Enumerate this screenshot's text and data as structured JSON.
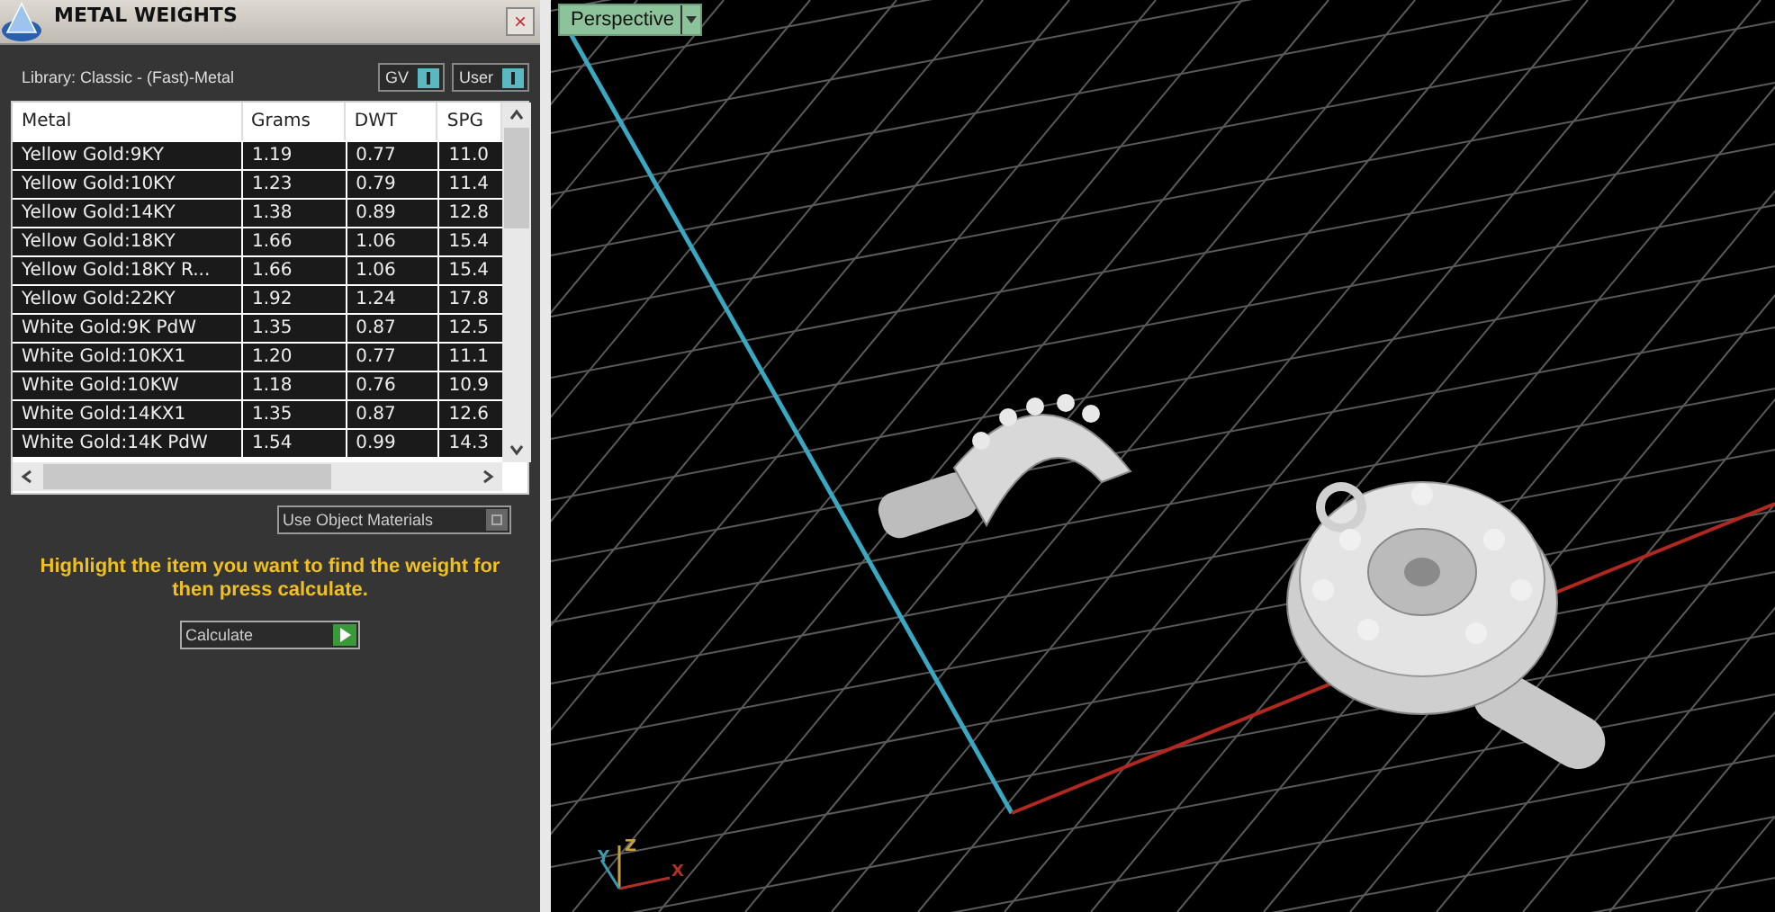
{
  "panel": {
    "title": "METAL WEIGHTS",
    "close": "×",
    "library": "Library: Classic - (Fast)-Metal",
    "toggles": [
      {
        "label": "GV",
        "on": true
      },
      {
        "label": "User",
        "on": true
      }
    ],
    "table": {
      "columns": [
        "Metal",
        "Grams",
        "DWT",
        "SPG"
      ],
      "rows": [
        {
          "cells": [
            "Yellow Gold:9KY",
            "1.19",
            "0.77",
            "11.0"
          ],
          "selected": false
        },
        {
          "cells": [
            "Yellow Gold:10KY",
            "1.23",
            "0.79",
            "11.4"
          ],
          "selected": false
        },
        {
          "cells": [
            "Yellow Gold:14KY",
            "1.38",
            "0.89",
            "12.8"
          ],
          "selected": false
        },
        {
          "cells": [
            "Yellow Gold:18KY",
            "1.66",
            "1.06",
            "15.4"
          ],
          "selected": false
        },
        {
          "cells": [
            "Yellow Gold:18KY R...",
            "1.66",
            "1.06",
            "15.4"
          ],
          "selected": false
        },
        {
          "cells": [
            "Yellow Gold:22KY",
            "1.92",
            "1.24",
            "17.8"
          ],
          "selected": false
        },
        {
          "cells": [
            "White Gold:9K PdW",
            "1.35",
            "0.87",
            "12.5"
          ],
          "selected": false
        },
        {
          "cells": [
            "White Gold:10KX1",
            "1.20",
            "0.77",
            "11.1"
          ],
          "selected": false
        },
        {
          "cells": [
            "White Gold:10KW",
            "1.18",
            "0.76",
            "10.9"
          ],
          "selected": false
        },
        {
          "cells": [
            "White Gold:14KX1",
            "1.35",
            "0.87",
            "12.6"
          ],
          "selected": false
        },
        {
          "cells": [
            "White Gold:14K PdW",
            "1.54",
            "0.99",
            "14.3"
          ],
          "selected": false
        }
      ]
    },
    "use_object_materials": {
      "label": "Use Object Materials",
      "on": false
    },
    "hint": "Highlight the item you want to find the weight for then press calculate.",
    "calculate": "Calculate"
  },
  "viewport": {
    "view_menu": "Perspective",
    "axis_labels": [
      "Z",
      "Y",
      "X"
    ]
  }
}
